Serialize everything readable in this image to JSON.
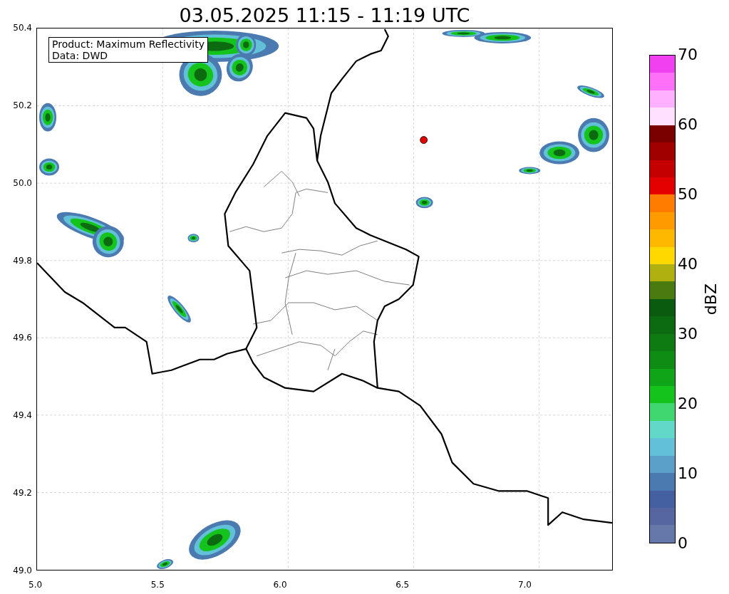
{
  "title": "03.05.2025 11:15 - 11:19 UTC",
  "annotation": [
    "Product: Maximum Reflectivity",
    "Data: DWD"
  ],
  "map": {
    "xticks": [
      "5.0",
      "5.5",
      "6.0",
      "6.5",
      "7.0"
    ],
    "yticks": [
      "50.4",
      "50.2",
      "50.0",
      "49.8",
      "49.6",
      "49.4",
      "49.2",
      "49.0"
    ]
  },
  "colorbar": {
    "label": "dBZ",
    "ticks": [
      "70",
      "60",
      "50",
      "40",
      "30",
      "20",
      "10",
      "0"
    ],
    "segments": [
      {
        "color": "#f040f0"
      },
      {
        "color": "#ff70f8"
      },
      {
        "color": "#ffb0ff"
      },
      {
        "color": "#ffe0ff"
      },
      {
        "color": "#7a0000"
      },
      {
        "color": "#a00000"
      },
      {
        "color": "#c40000"
      },
      {
        "color": "#e40000"
      },
      {
        "color": "#ff7c00"
      },
      {
        "color": "#ff9a00"
      },
      {
        "color": "#ffb800"
      },
      {
        "color": "#ffd800"
      },
      {
        "color": "#b0b010"
      },
      {
        "color": "#4a7a10"
      },
      {
        "color": "#0a5a10"
      },
      {
        "color": "#0c6a10"
      },
      {
        "color": "#0e7a12"
      },
      {
        "color": "#0e8c14"
      },
      {
        "color": "#10a418"
      },
      {
        "color": "#14c41c"
      },
      {
        "color": "#40d670"
      },
      {
        "color": "#62d8c8"
      },
      {
        "color": "#62c0d8"
      },
      {
        "color": "#5aa0c8"
      },
      {
        "color": "#4a7ab0"
      },
      {
        "color": "#4460a0"
      },
      {
        "color": "#5566a0"
      },
      {
        "color": "#6677aa"
      }
    ]
  }
}
